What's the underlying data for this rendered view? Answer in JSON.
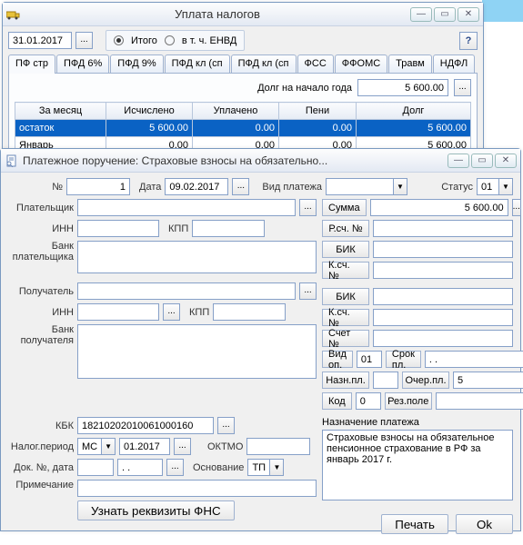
{
  "win1": {
    "title": "Уплата налогов",
    "date": "31.01.2017",
    "radio_total": "Итого",
    "radio_envd": "в т. ч. ЕНВД",
    "tabs": [
      "ПФ стр",
      "ПФД 6%",
      "ПФД 9%",
      "ПФД кл (сп",
      "ПФД кл (сп",
      "ФСС",
      "ФФОМС",
      "Травм",
      "НДФЛ"
    ],
    "debt_label": "Долг на начало года",
    "debt_value": "5 600.00",
    "grid_headers": [
      "За месяц",
      "Исчислено",
      "Уплачено",
      "Пени",
      "Долг"
    ],
    "grid_rows": [
      {
        "c0": "остаток",
        "c1": "5 600.00",
        "c2": "0.00",
        "c3": "0.00",
        "c4": "5 600.00",
        "sel": true
      },
      {
        "c0": "Январь",
        "c1": "0.00",
        "c2": "0.00",
        "c3": "0.00",
        "c4": "5 600.00",
        "sel": false
      }
    ]
  },
  "win2": {
    "title": "Платежное поручение:  Страховые взносы на обязательно...",
    "labels": {
      "number": "№",
      "date": "Дата",
      "payment_type": "Вид платежа",
      "status": "Статус",
      "payer": "Плательщик",
      "inn": "ИНН",
      "kpp": "КПП",
      "payer_bank": "Банк плательщика",
      "recipient": "Получатель",
      "recipient_bank": "Банк получателя",
      "sum": "Сумма",
      "rsch": "Р.сч. №",
      "bik": "БИК",
      "ksch": "К.сч. №",
      "schet": "Счет №",
      "vidop": "Вид оп.",
      "srokpl": "Срок пл.",
      "naznpl": "Назн.пл.",
      "ocherpl": "Очер.пл.",
      "kod": "Код",
      "rezpole": "Рез.поле",
      "kbk": "КБК",
      "nalog_period": "Налог.период",
      "oktmo": "ОКТМО",
      "dok": "Док. №, дата",
      "osnovanie": "Основание",
      "note": "Примечание",
      "purpose_header": "Назначение платежа",
      "fns": "Узнать реквизиты ФНС",
      "print": "Печать",
      "ok": "Ok"
    },
    "values": {
      "number": "1",
      "date": "09.02.2017",
      "payment_type": "",
      "status": "01",
      "sum": "5 600.00",
      "vidop": "01",
      "srokpl": ". .",
      "naznpl": "",
      "ocherpl": "5",
      "kod": "0",
      "rezpole": "",
      "kbk": "18210202010061000160",
      "nalog_period_type": "МС",
      "nalog_period": "01.2017",
      "oktmo": "",
      "dok": "",
      "osnovanie": "ТП",
      "dok_date": ". .",
      "purpose": "Страховые взносы на обязательное пенсионное страхование в РФ за январь 2017 г."
    }
  }
}
